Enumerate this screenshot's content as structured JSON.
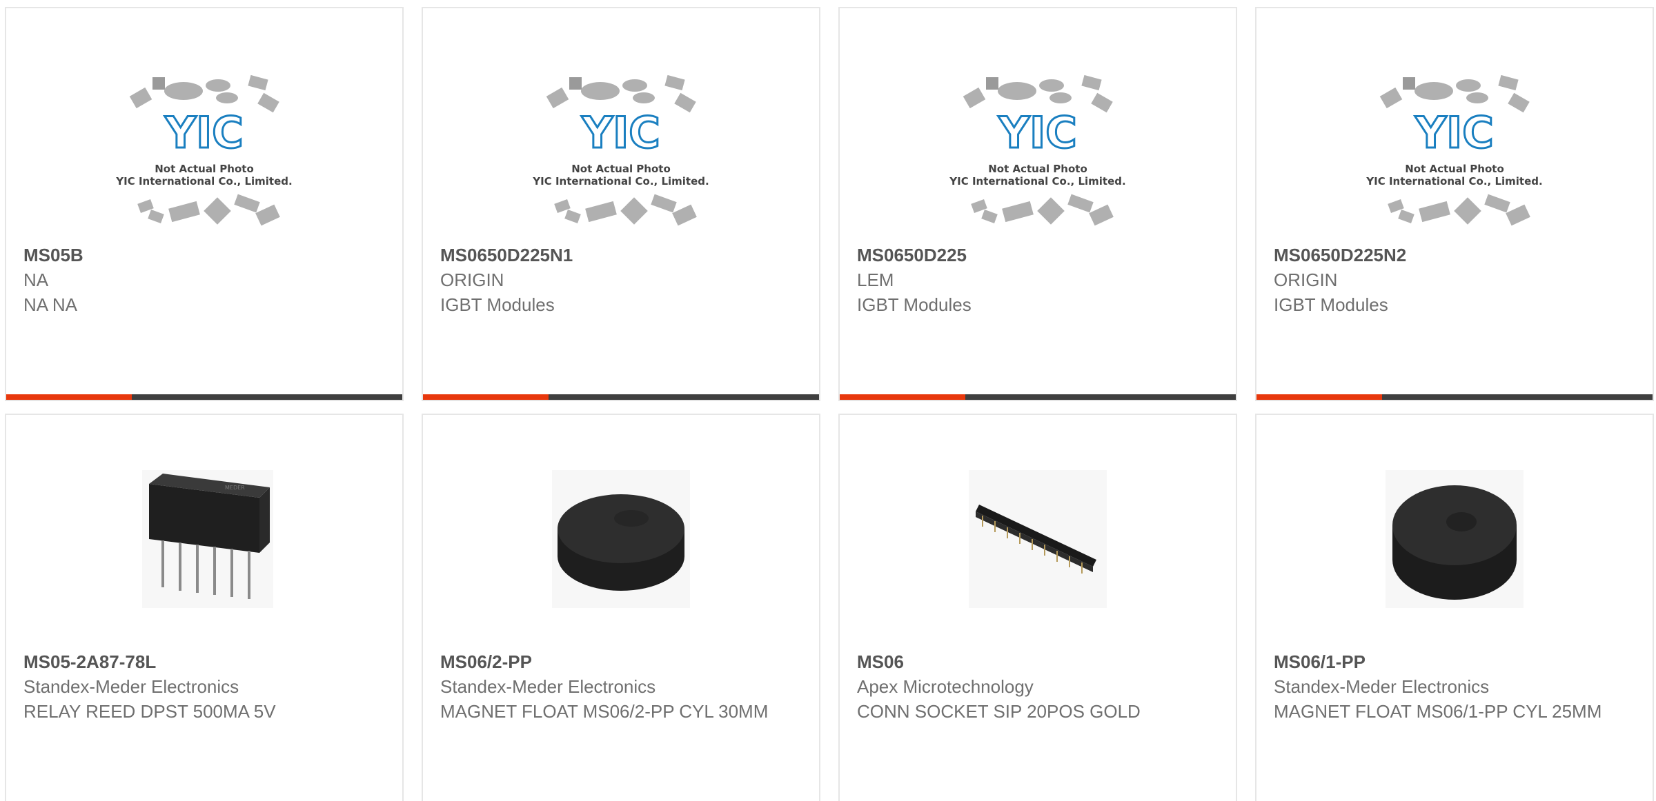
{
  "colors": {
    "accent": "#e8380d",
    "bar": "#3f3f3f",
    "logo": "#1a7fc0"
  },
  "placeholder": {
    "logo_text": "YIC",
    "line1": "Not Actual Photo",
    "line2": "YIC International Co., Limited."
  },
  "products": [
    {
      "part": "MS05B",
      "maker": "NA",
      "desc": "NA NA",
      "image": "placeholder-logo"
    },
    {
      "part": "MS0650D225N1",
      "maker": "ORIGIN",
      "desc": "IGBT Modules",
      "image": "placeholder-logo"
    },
    {
      "part": "MS0650D225",
      "maker": "LEM",
      "desc": "IGBT Modules",
      "image": "placeholder-logo"
    },
    {
      "part": "MS0650D225N2",
      "maker": "ORIGIN",
      "desc": "IGBT Modules",
      "image": "placeholder-logo"
    },
    {
      "part": "MS05-2A87-78L",
      "maker": "Standex-Meder Electronics",
      "desc": "RELAY REED DPST 500MA 5V",
      "image": "relay-icon"
    },
    {
      "part": "MS06/2-PP",
      "maker": "Standex-Meder Electronics",
      "desc": "MAGNET FLOAT MS06/2-PP CYL 30MM",
      "image": "magnet-float-icon"
    },
    {
      "part": "MS06",
      "maker": "Apex Microtechnology",
      "desc": "CONN SOCKET SIP 20POS GOLD",
      "image": "socket-strip-icon"
    },
    {
      "part": "MS06/1-PP",
      "maker": "Standex-Meder Electronics",
      "desc": "MAGNET FLOAT MS06/1-PP CYL 25MM",
      "image": "magnet-float-icon"
    }
  ]
}
